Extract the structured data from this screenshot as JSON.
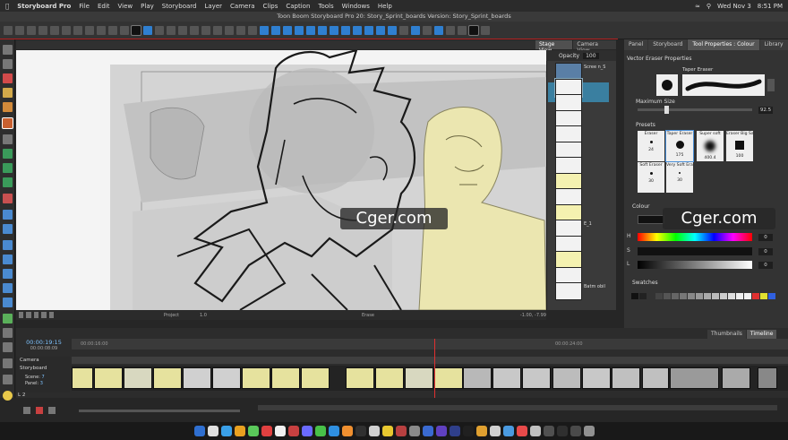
{
  "menubar": {
    "app": "Storyboard Pro",
    "items": [
      "File",
      "Edit",
      "View",
      "Play",
      "Storyboard",
      "Layer",
      "Camera",
      "Clips",
      "Caption",
      "Tools",
      "Windows",
      "Help"
    ],
    "date": "Wed Nov 3",
    "time": "8:51 PM"
  },
  "window": {
    "title": "Toon Boom Storyboard Pro 20: Story_Sprint_boards Version: Story_Sprint_boards"
  },
  "stage": {
    "tabs": [
      "Stage View",
      "Camera View"
    ],
    "bottom_labels": [
      "Project",
      "1.0",
      "Erase",
      "-1.00, -7.99"
    ]
  },
  "thumbnails": {
    "header": {
      "opacity_label": "Opacity",
      "opacity_value": "100"
    },
    "layer_labels": [
      "Scree n_Sho t 2021...",
      "",
      "",
      "",
      "",
      "",
      "",
      "",
      "",
      "",
      "E_1",
      "",
      "",
      "",
      "Batm obile_ 007"
    ]
  },
  "right_panel": {
    "tabs": [
      "Panel",
      "Storyboard",
      "Tool Properties : Colour",
      "Library"
    ],
    "vector_eraser_title": "Vector Eraser Properties",
    "tip_label": "Taper Eraser",
    "max_size_label": "Maximum Size",
    "max_size_value": "92.5",
    "presets_label": "Presets",
    "presets": [
      {
        "name": "Eraser",
        "value": "24"
      },
      {
        "name": "Taper Eraser",
        "value": "175"
      },
      {
        "name": "Super soft",
        "value": "400.4"
      },
      {
        "name": "Eraser Big Sa...",
        "value": "100"
      },
      {
        "name": "Soft Eraser",
        "value": "30"
      },
      {
        "name": "Very Soft Eraser",
        "value": "30"
      }
    ],
    "colour_label": "Colour",
    "colour_rows": [
      {
        "label": "H",
        "value": "0"
      },
      {
        "label": "S",
        "value": "0"
      },
      {
        "label": "L",
        "value": "0"
      }
    ],
    "swatches_label": "Swatches"
  },
  "timeline": {
    "tabs": [
      "Thumbnails",
      "Timeline"
    ],
    "timecode_main": "00:00:19:15",
    "timecode_sub": "00:00:08:09",
    "ruler_marks": [
      "00:00:16:00",
      "00:00:24:00"
    ],
    "tracks": {
      "camera": "Camera",
      "storyboard": "Storyboard",
      "scene_label": "Scene:",
      "scene_value": "7",
      "panel_label": "Panel:",
      "panel_value": "3",
      "audio": "L 2"
    }
  },
  "watermark": "Cger.com"
}
